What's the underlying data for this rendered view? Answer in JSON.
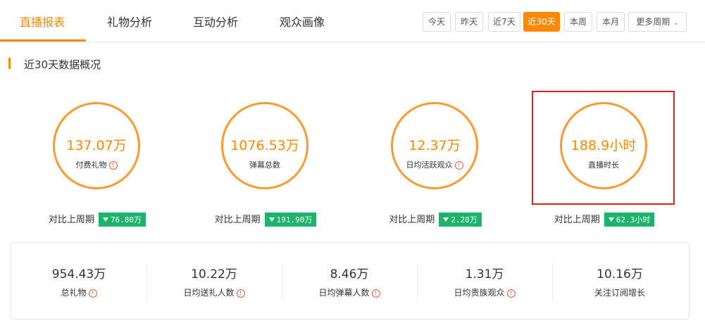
{
  "tabs": [
    {
      "label": "直播报表",
      "active": true
    },
    {
      "label": "礼物分析",
      "active": false
    },
    {
      "label": "互动分析",
      "active": false
    },
    {
      "label": "观众画像",
      "active": false
    }
  ],
  "filters": {
    "buttons": [
      {
        "label": "今天",
        "active": false
      },
      {
        "label": "昨天",
        "active": false
      },
      {
        "label": "近7天",
        "active": false
      },
      {
        "label": "近30天",
        "active": true
      },
      {
        "label": "本周",
        "active": false
      },
      {
        "label": "本月",
        "active": false
      }
    ],
    "more_label": "更多周期"
  },
  "section": {
    "title": "近30天数据概况"
  },
  "compare_label": "对比上周期",
  "metrics": [
    {
      "value": "137.07万",
      "label": "付费礼物",
      "has_info": true,
      "change": "76.80万",
      "direction": "down"
    },
    {
      "value": "1076.53万",
      "label": "弹幕总数",
      "has_info": false,
      "change": "191.90万",
      "direction": "down"
    },
    {
      "value": "12.37万",
      "label": "日均活跃观众",
      "has_info": true,
      "change": "2.20万",
      "direction": "down"
    },
    {
      "value": "188.9小时",
      "label": "直播时长",
      "has_info": false,
      "change": "62.3小时",
      "direction": "down"
    }
  ],
  "summary": [
    {
      "value": "954.43万",
      "label": "总礼物"
    },
    {
      "value": "10.22万",
      "label": "日均送礼人数"
    },
    {
      "value": "8.46万",
      "label": "日均弹幕人数"
    },
    {
      "value": "1.31万",
      "label": "日均贵族观众"
    },
    {
      "value": "10.16万",
      "label": "关注订阅增长"
    }
  ],
  "colors": {
    "accent": "#ff8a00",
    "badge": "#1cb36a",
    "highlight": "#e02020",
    "info": "#ff5a3c"
  }
}
